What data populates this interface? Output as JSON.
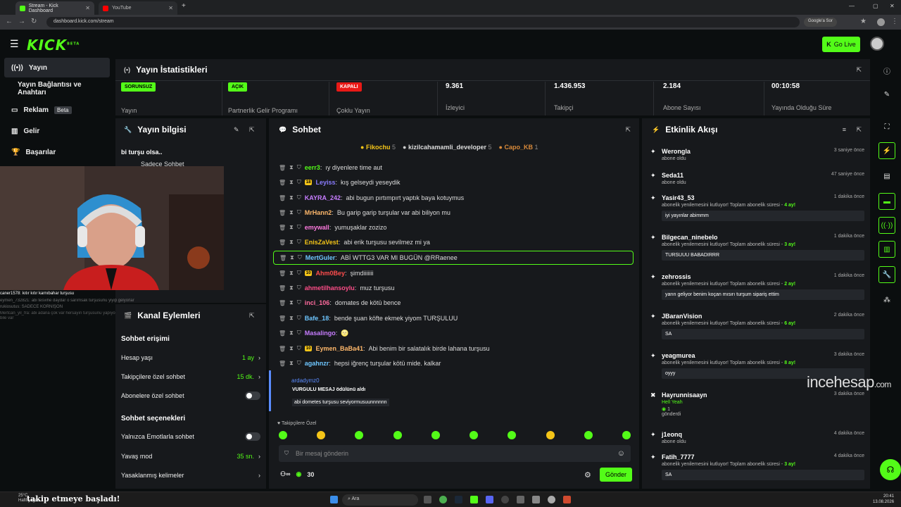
{
  "browser": {
    "tabs": [
      {
        "title": "Stream - Kick Dashboard",
        "active": true
      },
      {
        "title": "YouTube",
        "active": false
      }
    ],
    "url": "dashboard.kick.com/stream",
    "google_button": "Google'a Sor"
  },
  "header": {
    "logo": "KICK",
    "logo_beta": "BETA",
    "go_live": "Go Live"
  },
  "sidebar": {
    "items": [
      {
        "label": "Yayın",
        "icon": "broadcast-icon"
      },
      {
        "label": "Yayın Bağlantısı ve Anahtarı",
        "icon": "key-icon"
      },
      {
        "label": "Reklam",
        "icon": "ad-icon",
        "badge": "Beta"
      },
      {
        "label": "Gelir",
        "icon": "chart-icon"
      },
      {
        "label": "Başarılar",
        "icon": "trophy-icon"
      }
    ]
  },
  "stats": {
    "title": "Yayın İstatistikleri",
    "cards": [
      {
        "tag": "SORUNSUZ",
        "tag_color": "#53fc18",
        "label": "Yayın"
      },
      {
        "tag": "AÇIK",
        "tag_color": "#53fc18",
        "label": "Partnerlik Gelir Programı"
      },
      {
        "tag": "KAPALI",
        "tag_color": "#e91916",
        "label": "Çoklu Yayın"
      },
      {
        "value": "9.361",
        "label": "İzleyici"
      },
      {
        "value": "1.436.953",
        "label": "Takipçi"
      },
      {
        "value": "2.184",
        "label": "Abone Sayısı"
      },
      {
        "value": "00:10:58",
        "label": "Yayında Olduğu Süre"
      }
    ]
  },
  "stream_info": {
    "title": "Yayın bilgisi",
    "stream_title": "bi turşu olsa..",
    "category": "Sadece Sohbet"
  },
  "webcam_chat": {
    "lines": [
      "caner1578: kıtır kıtır karnıbahar turşusu",
      "eymen_732821: abi tesvihe daydar o sarımsak turşusunu yiyip gelyorlar",
      "rukiosutus: SADECE KORNİŞON",
      "Mertcan_yil_fra: abi adana çok var hersayın turşusunu yapıyor bizde",
      "bile var"
    ]
  },
  "channel_actions": {
    "title": "Kanal Eylemleri",
    "chat_access_heading": "Sohbet erişimi",
    "account_age_label": "Hesap yaşı",
    "account_age_value": "1 ay",
    "followers_only_label": "Takipçilere özel sohbet",
    "followers_only_value": "15 dk.",
    "subs_only_label": "Abonelere özel sohbet",
    "chat_options_heading": "Sohbet seçenekleri",
    "emotes_only_label": "Yalnızca Emotlarla sohbet",
    "slow_mode_label": "Yavaş mod",
    "slow_mode_value": "35 sn.",
    "banned_words_label": "Yasaklanmış kelimeler"
  },
  "chat": {
    "title": "Sohbet",
    "top_gifters": [
      {
        "name": "Fikochu",
        "count": "5"
      },
      {
        "name": "kizilcahamamli_developer",
        "count": "5"
      },
      {
        "name": "Capo_KB",
        "count": "1"
      }
    ],
    "messages": [
      {
        "user": "eerr3",
        "color": "#53fc18",
        "text": "ıy diyenlere time aut"
      },
      {
        "user": "Leyiss",
        "color": "#8a7cff",
        "badge": "18",
        "text": "kış gelseydi yeseydik"
      },
      {
        "user": "KAYRA_242",
        "color": "#c77dff",
        "text": "abi bugun pırtımpırt yaptık baya kotuymus"
      },
      {
        "user": "MrHann2",
        "color": "#ffb86b",
        "text": "Bu garip garip turşular var abi biliyon mu"
      },
      {
        "user": "emywall",
        "color": "#ff7adf",
        "text": "yumuşaklar zozizo"
      },
      {
        "user": "EnisZaVest",
        "color": "#f5c518",
        "text": "abi erik turşusu sevilmez mi ya"
      },
      {
        "user": "MertGuler",
        "color": "#6ec6ff",
        "text": "ABİ WTTG3 VAR MI BUGÜN @RRaenee",
        "highlight": true
      },
      {
        "user": "Ahm0Bey",
        "color": "#ff4d4d",
        "badge": "10",
        "text": "şimdiiiiiii"
      },
      {
        "user": "ahmetilhansoylu",
        "color": "#ff4d88",
        "text": "muz turşusu"
      },
      {
        "user": "inci_106",
        "color": "#ff6b9d",
        "text": "domates de kötü bence"
      },
      {
        "user": "Bafe_18",
        "color": "#6ec6ff",
        "text": "bende şuan köfte ekmek yiyom TURŞULUU"
      },
      {
        "user": "Masalingo",
        "color": "#c77dff",
        "text": "🌝"
      },
      {
        "user": "Eymen_BaBa41",
        "color": "#ffb86b",
        "badge": "10",
        "text": "Abi benim bir salatalık birde lahana turşusu"
      },
      {
        "user": "agahnzr",
        "color": "#6ec6ff",
        "text": "hepsi iğrenç turşular kötü mide. kalkar"
      }
    ],
    "reward": {
      "user": "ardadymz0",
      "action": "VURGULU MESAJ ödülünü aldı",
      "message": "abi dometes turşusu seviyormusuunnnnnn"
    },
    "emote_section": "Takipçilere Özel",
    "input_placeholder": "Bir mesaj gönderin",
    "points": "30",
    "send_button": "Gönder"
  },
  "feed": {
    "title": "Etkinlik Akışı",
    "items": [
      {
        "name": "Werongla",
        "sub": "abone oldu",
        "time": "3 saniye önce"
      },
      {
        "name": "Seda11",
        "sub": "abone oldu",
        "time": "47 saniye önce"
      },
      {
        "name": "Yasir43_53",
        "sub": "abonelik yenilemesini kutluyor! Toplam abonelik süresi - ",
        "months": "4 ay!",
        "time": "1 dakika önce",
        "message": "iyi yayınlar abimmm"
      },
      {
        "name": "Bilgecan_ninebelo",
        "sub": "abonelik yenilemesini kutluyor! Toplam abonelik süresi - ",
        "months": "3 ay!",
        "time": "1 dakika önce",
        "message": "TURSUUU BABADIRRR"
      },
      {
        "name": "zehrossis",
        "sub": "abonelik yenilemesini kutluyor! Toplam abonelik süresi - ",
        "months": "2 ay!",
        "time": "1 dakika önce",
        "message": "yarın geliyor benim koçan mısırı turşum sipariş ettim"
      },
      {
        "name": "JBaranVision",
        "sub": "abonelik yenilemesini kutluyor! Toplam abonelik süresi - ",
        "months": "6 ay!",
        "time": "2 dakika önce",
        "message": "SA"
      },
      {
        "name": "yeagmurea",
        "sub": "abonelik yenilemesini kutluyor! Toplam abonelik süresi - ",
        "months": "8 ay!",
        "time": "3 dakika önce",
        "message": "oyyy"
      },
      {
        "name": "Hayrunnisaayn",
        "sub": "Hell Yeah",
        "gift": "1",
        "gift_label": "gönderdi",
        "time": "3 dakika önce"
      },
      {
        "name": "j1eonq",
        "sub": "abone oldu",
        "time": "4 dakika önce"
      },
      {
        "name": "Fatih_7777",
        "sub": "abonelik yenilemesini kutluyor! Toplam abonelik süresi - ",
        "months": "3 ay!",
        "time": "4 dakika önce",
        "message": "SA"
      }
    ]
  },
  "watermark": {
    "main": "incehesap",
    "domain": ".com"
  },
  "taskbar": {
    "weather_temp": "25°C",
    "weather_text": "Hafif yağm.",
    "ticker": "takip etmeye başladı!",
    "search": "Ara",
    "time": "20:41",
    "date": "13.08.2026"
  },
  "colors": {
    "accent": "#53fc18",
    "panel": "#17191c",
    "bg": "#0b0e0f"
  }
}
